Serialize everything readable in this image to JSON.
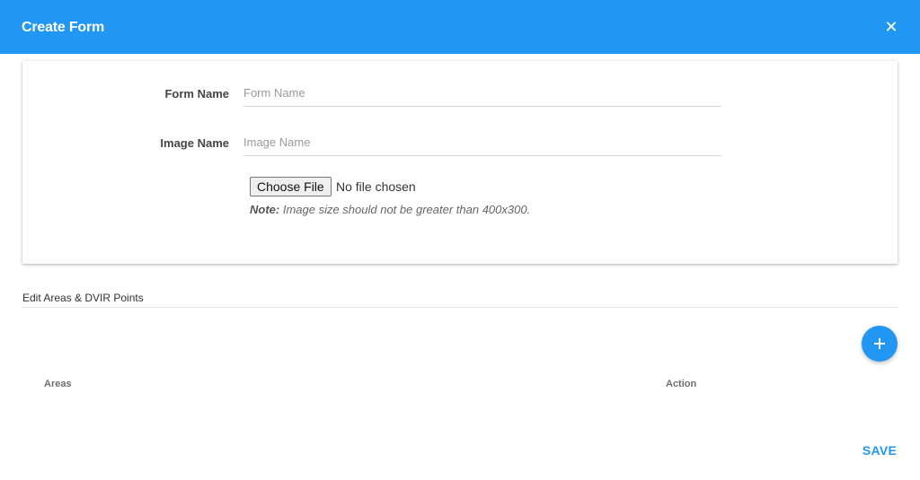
{
  "header": {
    "title": "Create Form",
    "close_glyph": "✕",
    "close_icon": "close-icon",
    "background_color": "#2196f3"
  },
  "form": {
    "form_name": {
      "label": "Form Name",
      "placeholder": "Form Name",
      "value": ""
    },
    "image_name": {
      "label": "Image Name",
      "placeholder": "Image Name",
      "value": ""
    },
    "file": {
      "button_label": "Choose File",
      "status": "No file chosen"
    },
    "note": {
      "prefix": "Note:",
      "text": " Image size should not be greater than 400x300."
    }
  },
  "areas_section": {
    "title": "Edit Areas & DVIR Points",
    "add_icon": "plus-icon",
    "table": {
      "columns": [
        "Areas",
        "Action"
      ]
    }
  },
  "footer": {
    "save_label": "SAVE"
  },
  "colors": {
    "accent": "#2196f3"
  }
}
